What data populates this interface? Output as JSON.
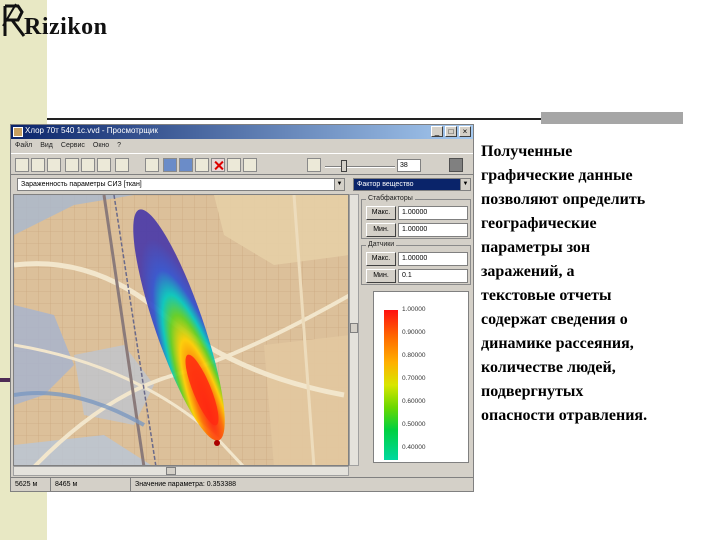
{
  "logo": {
    "text": "Rizikon"
  },
  "window": {
    "title": "Хлор 70т 540 1c.vvd - Просмотрщик",
    "controls": [
      "_",
      "□",
      "×"
    ],
    "menu": [
      "Файл",
      "Вид",
      "Сервис",
      "Окно",
      "?"
    ],
    "toolbar_icons": [
      "open-icon",
      "save-icon",
      "print-icon",
      "copy-icon",
      "paste-icon",
      "find-icon",
      "pointer-icon",
      "zoom-icon",
      "print-preview-icon",
      "layers-icon",
      "object-icon",
      "measure-icon",
      "delete-icon",
      "table-icon",
      "refresh-icon"
    ],
    "zoom_value": "38",
    "layer_combo": "Зараженность параметры  СИЗ [ткан]",
    "param_combo": "Фактор вещество"
  },
  "panel": {
    "group1_label": "Стабфакторы",
    "max_label": "Макс.",
    "max_value": "1.00000",
    "min_label": "Мин.",
    "min_value": "1.00000",
    "group2_label": "Датчики",
    "max2_label": "Макс.",
    "max2_value": "1.00000",
    "min2_label": "Мин.",
    "min2_value": "0.1"
  },
  "legend": {
    "labels": [
      "1.00000",
      "0.90000",
      "0.80000",
      "0.70000",
      "0.60000",
      "0.50000",
      "0.40000"
    ]
  },
  "status": {
    "x": "5625 м",
    "y": "8465 м",
    "value": "Значение параметра: 0.353388"
  },
  "caption": "Полученные\nграфические данные\nпозволяют определить\nгеографические\nпараметры зон\nзаражений, а\nтекстовые отчеты\nсодержат сведения о\nдинамике рассеяния,\nколичестве людей,\nподвергнутых\nопасности отравления.",
  "colors": {
    "titlebar": "#0a246a",
    "map_base": "#d9ba8e",
    "plume_core": "#ff1010",
    "plume_edge": "#3040c0"
  }
}
